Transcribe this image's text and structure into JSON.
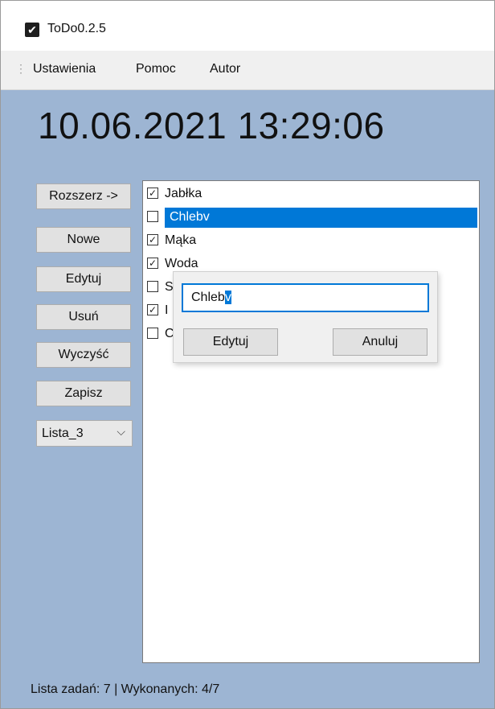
{
  "window": {
    "title": "ToDo0.2.5",
    "icon": "checkbox-icon"
  },
  "menu": [
    {
      "label": "Ustawienia"
    },
    {
      "label": "Pomoc"
    },
    {
      "label": "Autor"
    }
  ],
  "clock": "10.06.2021 13:29:06",
  "buttons": {
    "expand": "Rozszerz ->",
    "new": "Nowe",
    "edit": "Edytuj",
    "delete": "Usuń",
    "clear": "Wyczyść",
    "save": "Zapisz"
  },
  "list_select": {
    "value": "Lista_3"
  },
  "tasks": [
    {
      "label": "Jabłka",
      "checked": true
    },
    {
      "label": "Chlebv",
      "checked": false,
      "selected": true
    },
    {
      "label": "Mąka",
      "checked": true
    },
    {
      "label": "Woda",
      "checked": true
    },
    {
      "label": "S",
      "checked": false
    },
    {
      "label": "I",
      "checked": true
    },
    {
      "label": "C",
      "checked": false
    }
  ],
  "edit_dialog": {
    "value_prefix": "Chleb",
    "value_selected": "v",
    "ok_label": "Edytuj",
    "cancel_label": "Anuluj"
  },
  "status": "Lista zadań: 7 | Wykonanych: 4/7",
  "colors": {
    "background": "#9db5d3",
    "selection": "#0078d7"
  }
}
